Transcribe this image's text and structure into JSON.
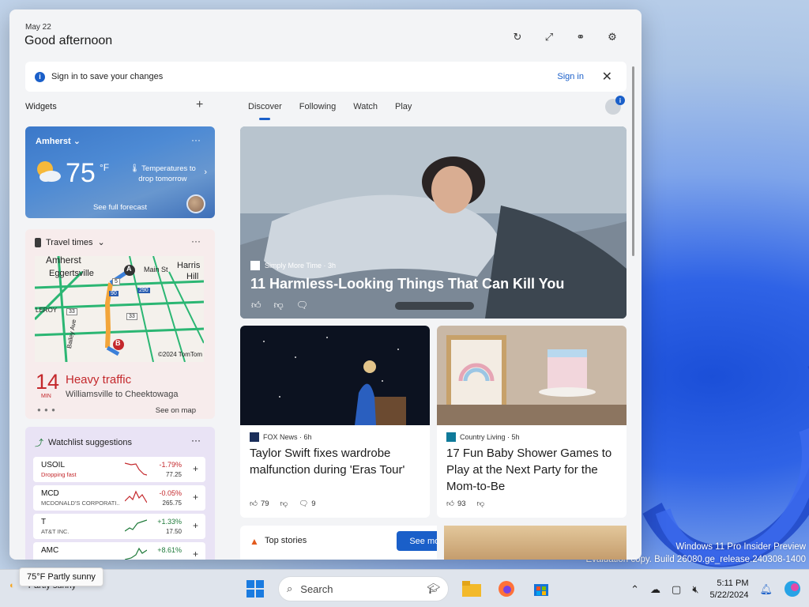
{
  "header": {
    "date": "May 22",
    "greeting": "Good afternoon"
  },
  "header_icons": [
    "refresh-icon",
    "expand-icon",
    "pin-icon",
    "settings-icon"
  ],
  "signin_bar": {
    "message": "Sign in to save your changes",
    "link": "Sign in"
  },
  "widgets": {
    "label": "Widgets"
  },
  "weather": {
    "location": "Amherst",
    "temp": "75",
    "unit": "°F",
    "note_line1": "Temperatures to",
    "note_line2": "drop tomorrow",
    "forecast_link": "See full forecast"
  },
  "traffic": {
    "title": "Travel times",
    "map_labels": [
      "Amherst",
      "Eggertsville",
      "Main St",
      "Harris",
      "Hill",
      "LEROY",
      "Bailey Ave",
      "©2024 TomTom",
      "A",
      "B",
      "5",
      "90",
      "33",
      "33",
      "290"
    ],
    "minutes": "14",
    "min_label": "MIN",
    "status": "Heavy traffic",
    "route": "Williamsville to Cheektowaga",
    "see_map": "See on map"
  },
  "watchlist": {
    "title": "Watchlist suggestions",
    "stocks": [
      {
        "symbol": "USOIL",
        "name": "Dropping fast",
        "change": "-1.79%",
        "price": "77.25",
        "direction": "down"
      },
      {
        "symbol": "MCD",
        "name": "MCDONALD'S CORPORATI...",
        "change": "-0.05%",
        "price": "265.75",
        "direction": "down"
      },
      {
        "symbol": "T",
        "name": "AT&T INC.",
        "change": "+1.33%",
        "price": "17.50",
        "direction": "up"
      },
      {
        "symbol": "AMC",
        "name": "",
        "change": "+8.61%",
        "price": "",
        "direction": "up"
      }
    ]
  },
  "feed_tabs": [
    "Discover",
    "Following",
    "Watch",
    "Play"
  ],
  "hero": {
    "source": "Simply More Time · 3h",
    "title": "11 Harmless-Looking Things That Can Kill You"
  },
  "cards": [
    {
      "source": "FOX News · 6h",
      "title": "Taylor Swift fixes wardrobe malfunction during 'Eras Tour'",
      "likes": "79",
      "comments": "9"
    },
    {
      "source": "Country Living · 5h",
      "title": "17 Fun Baby Shower Games to Play at the Next Party for the Mom-to-Be",
      "likes": "93",
      "comments": ""
    }
  ],
  "top_stories": {
    "label": "Top stories",
    "button": "See more"
  },
  "watermark": {
    "line1": "Windows 11 Pro Insider Preview",
    "line2": "Evaluation copy. Build 26080.ge_release.240308-1400"
  },
  "taskbar": {
    "weather_tooltip": "75°F Partly sunny",
    "weather_text": "Partly sunny",
    "search_placeholder": "Search",
    "time": "5:11 PM",
    "date": "5/22/2024"
  },
  "colors": {
    "accent": "#1a5fc9",
    "traffic_red": "#c4282c",
    "stock_up": "#1f7a3a",
    "stock_down": "#c4282c"
  }
}
